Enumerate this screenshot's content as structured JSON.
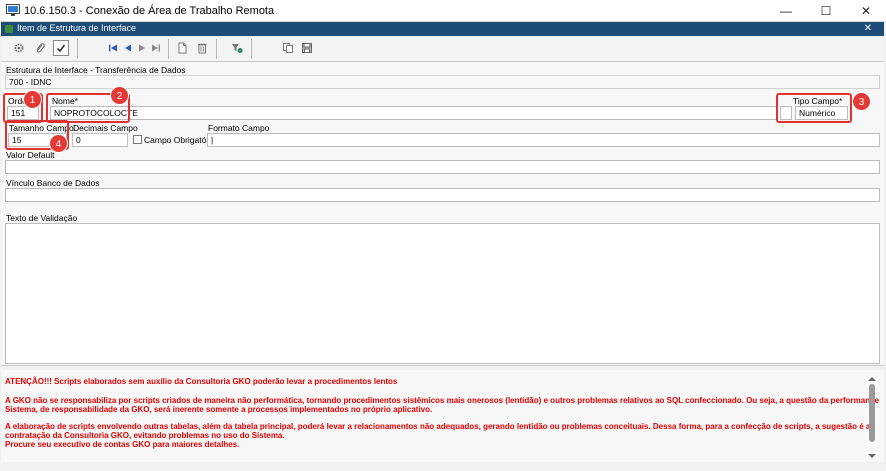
{
  "window": {
    "title": "10.6.150.3 - Conexão de Área de Trabalho Remota",
    "minimize_glyph": "—",
    "maximize_glyph": "☐",
    "close_glyph": "✕"
  },
  "inner": {
    "title": "Item de Estrutura de Interface",
    "close_glyph": "✕"
  },
  "toolbar": {
    "icons": [
      "gear-icon",
      "attach-icon",
      "check-icon",
      "first-icon",
      "prev-icon",
      "next-icon",
      "last-icon",
      "new-icon",
      "delete-icon",
      "filter-icon",
      "copy-icon",
      "save-icon"
    ]
  },
  "form": {
    "structure_label": "Estrutura de Interface - Transferência de Dados",
    "structure_value": "700 - IDNC",
    "order_label": "Ordem*",
    "order_value": "151",
    "name_label": "Nome*",
    "name_value": "NOPROTOCOLOCTE",
    "field_type_label": "Tipo Campo*",
    "field_type_value": "Numérico",
    "size_label": "Tamanho Campo",
    "size_value": "15",
    "decimals_label": "Decimais Campo",
    "decimals_value": "0",
    "required_label": "Campo Obrigatório",
    "format_label": "Formato Campo",
    "format_value": "|",
    "default_label": "Valor Default",
    "db_link_label": "Vínculo Banco de Dados",
    "validation_label": "Texto de Validação"
  },
  "badges": [
    "1",
    "2",
    "3",
    "4"
  ],
  "warning": {
    "line1": "ATENÇÃO!!! Scripts elaborados sem auxílio da Consultoria GKO poderão levar a procedimentos lentos",
    "line2": "A GKO não se responsabiliza por scripts criados de maneira não performática, tornando procedimentos sistêmicos mais onerosos (lentidão) e outros problemas relativos ao SQL confeccionado. Ou seja, a questão da performance",
    "line3": "Sistema, de responsabilidade da GKO, será inerente somente a processos implementados no próprio aplicativo.",
    "line4": "A elaboração de scripts envolvendo outras tabelas, além da tabela principal, poderá levar a relacionamentos não adequados, gerando lentidão ou problemas conceituais. Dessa forma, para a confecção de scripts, a sugestão é a",
    "line5": "contratação da Consultoria GKO, evitando problemas no uso do Sistema.",
    "line6": "Procure seu executivo de contas GKO para maiores detalhes."
  },
  "colors": {
    "accent": "#1e4c78",
    "highlight": "#e03030",
    "warning": "#e00000"
  }
}
